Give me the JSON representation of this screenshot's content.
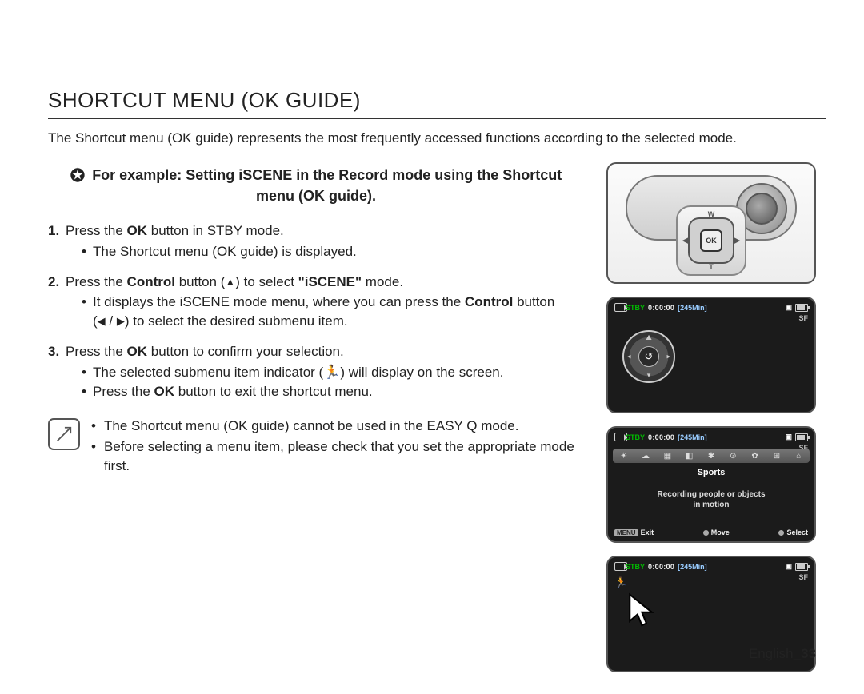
{
  "title": "SHORTCUT MENU (OK GUIDE)",
  "intro": "The Shortcut menu (OK guide) represents the most frequently accessed functions according to the selected mode.",
  "example_line1": "For example: Setting iSCENE in the Record mode using the Shortcut",
  "example_line2": "menu (OK guide).",
  "step1_a": "Press the ",
  "step1_b": "OK",
  "step1_c": " button in STBY mode.",
  "step1_sub": "The Shortcut menu (OK guide) is displayed.",
  "step2_a": "Press the ",
  "step2_b": "Control",
  "step2_c": " button (",
  "step2_d": ") to select ",
  "step2_e": "\"iSCENE\"",
  "step2_f": " mode.",
  "step2_sub_a": "It displays the iSCENE mode menu, where you can press the ",
  "step2_sub_b": "Control",
  "step2_sub_c": " button",
  "step2_sub_d": "(",
  "step2_sub_e": " / ",
  "step2_sub_f": ") to select the desired submenu item.",
  "step3_a": "Press the ",
  "step3_b": "OK",
  "step3_c": " button to confirm your selection.",
  "step3_sub1_a": "The selected submenu item indicator (",
  "step3_sub1_b": ") will display on the screen.",
  "step3_sub2_a": "Press the ",
  "step3_sub2_b": "OK",
  "step3_sub2_c": " button to exit the shortcut menu.",
  "note1": "The Shortcut menu (OK guide) cannot be used in the EASY Q mode.",
  "note2": "Before selecting a menu item, please check that you set the appropriate mode first.",
  "cam": {
    "ok": "OK",
    "w": "W",
    "t": "T",
    "left": "◀",
    "right": "▶"
  },
  "lcd": {
    "stby": "STBY",
    "time": "0:00:00",
    "dur": "[245Min]",
    "sf": "SF",
    "scene_label": "Sports",
    "desc1": "Recording people or objects",
    "desc2": "in motion",
    "menu": "MENU",
    "exit": "Exit",
    "move": "Move",
    "select": "Select",
    "icons": [
      "☀",
      "☁",
      "▦",
      "◧",
      "✱",
      "⊙",
      "✿",
      "⊞",
      "⌂"
    ],
    "wheel_center": "↺"
  },
  "footer_lang": "English",
  "footer_page": "_33"
}
